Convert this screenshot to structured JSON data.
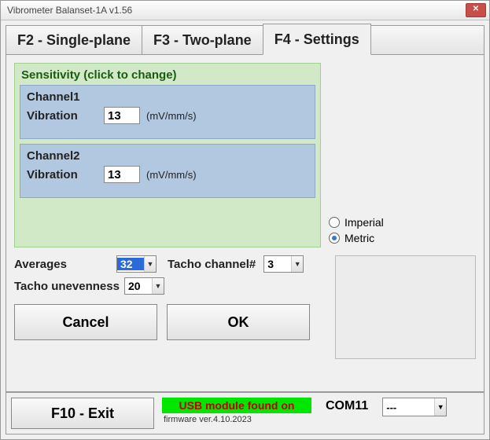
{
  "window": {
    "title": "Vibrometer Balanset-1A  v1.56"
  },
  "tabs": {
    "single": "F2 - Single-plane",
    "two": "F3 - Two-plane",
    "settings": "F4 - Settings",
    "active": "settings"
  },
  "sensitivity": {
    "group_title": "Sensitivity (click to change)",
    "channel1": {
      "title": "Channel1",
      "label": "Vibration",
      "value": "13",
      "unit": "(mV/mm/s)"
    },
    "channel2": {
      "title": "Channel2",
      "label": "Vibration",
      "value": "13",
      "unit": "(mV/mm/s)"
    }
  },
  "units": {
    "imperial": {
      "label": "Imperial",
      "checked": false
    },
    "metric": {
      "label": "Metric",
      "checked": true
    }
  },
  "params": {
    "averages": {
      "label": "Averages",
      "value": "32"
    },
    "tacho_channel": {
      "label": "Tacho channel#",
      "value": "3"
    },
    "tacho_unevenness": {
      "label": "Tacho unevenness",
      "value": "20"
    }
  },
  "buttons": {
    "cancel": "Cancel",
    "ok": "OK",
    "exit": "F10 - Exit"
  },
  "footer": {
    "usb_status": "USB module found on",
    "firmware": "firmware ver.4.10.2023",
    "com_label": "COM11",
    "com_select": "---"
  }
}
